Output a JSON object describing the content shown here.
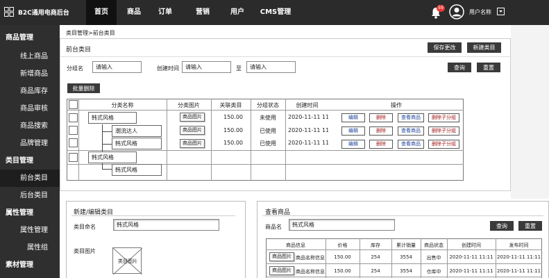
{
  "app": {
    "title": "B2C通用电商后台"
  },
  "nav": [
    {
      "label": "首页",
      "active": true
    },
    {
      "label": "商品",
      "active": false
    },
    {
      "label": "订单",
      "active": false
    },
    {
      "label": "营销",
      "active": false
    },
    {
      "label": "用户",
      "active": false
    },
    {
      "label": "CMS管理",
      "active": false
    }
  ],
  "header": {
    "notification_count": "59",
    "username": "用户名称"
  },
  "sidebar": {
    "groups": [
      {
        "label": "商品管理",
        "items": [
          "线上商品",
          "新增商品",
          "商品库存",
          "商品审核",
          "商品搜索",
          "品牌管理"
        ]
      },
      {
        "label": "类目管理",
        "items": [
          "前台类目",
          "后台类目"
        ]
      },
      {
        "label": "属性管理",
        "items": [
          "属性管理",
          "属性组"
        ]
      },
      {
        "label": "素材管理",
        "items": []
      }
    ],
    "active_item": "前台类目"
  },
  "breadcrumb": "类目管理>前台类目",
  "main": {
    "title": "前台类目",
    "save_button": "保存更改",
    "new_button": "新建类目",
    "filters": {
      "group_label": "分组名",
      "group_placeholder": "请输入",
      "created_label": "创建时间",
      "created_from_placeholder": "请输入",
      "to_label": "至",
      "created_to_placeholder": "请输入",
      "search_button": "查询",
      "reset_button": "重置"
    },
    "bulk_delete_button": "批量删除",
    "table": {
      "headers": [
        "分类名称",
        "分类图片",
        "关联类目",
        "分组状态",
        "创建时间",
        "操作"
      ],
      "rows": [
        {
          "name": "韩式风格",
          "image": "商品图片",
          "linked": "150.00",
          "status": "未使用",
          "created": "2020-11-11 11:11",
          "ops": [
            "编辑",
            "删除",
            "查看商品",
            "删除子分组"
          ]
        },
        {
          "name": "潮流达人",
          "image": "商品图片",
          "linked": "150.00",
          "status": "已使用",
          "created": "2020-11-11 11:11",
          "ops": [
            "编辑",
            "删除",
            "查看商品",
            "删除子分组"
          ]
        },
        {
          "name": "韩式风格",
          "image": "商品图片",
          "linked": "150.00",
          "status": "已使用",
          "created": "2020-11-11 11:11",
          "ops": [
            "编辑",
            "删除",
            "查看商品",
            "删除子分组"
          ]
        },
        {
          "name": "韩式风格"
        },
        {
          "name": "韩式风格"
        }
      ]
    }
  },
  "edit_panel": {
    "title": "新建/编辑类目",
    "name_label": "类目命名",
    "name_value": "韩式风格",
    "image_label": "类目图片",
    "image_placeholder": "类目图片"
  },
  "view_panel": {
    "title": "查看商品",
    "name_label": "商品名",
    "name_value": "韩式风格",
    "search_button": "查询",
    "reset_button": "重置",
    "headers": [
      "商品信息",
      "价格",
      "库存",
      "累计销量",
      "商品状态",
      "创建时间",
      "发布时间"
    ],
    "rows": [
      {
        "image": "商品图片",
        "info": "商品名称信息",
        "price": "150.00",
        "stock": "254",
        "sales": "3554",
        "status": "出售中",
        "created": "2020-11-11 11:11",
        "published": "2020-11-11 11:11"
      },
      {
        "image": "商品图片",
        "info": "商品名称信息",
        "price": "150.00",
        "stock": "254",
        "sales": "3554",
        "status": "仓库中",
        "created": "2020-11-11 11:11",
        "published": "2020-11-11 11:11"
      }
    ]
  },
  "colors": {
    "topbar": "#2b2b2b",
    "sidebar": "#2f2f2f",
    "dark_button": "#3a3a3a",
    "badge": "#e53935",
    "link_blue": "#1a3f9a",
    "link_red": "#a11a1a"
  }
}
